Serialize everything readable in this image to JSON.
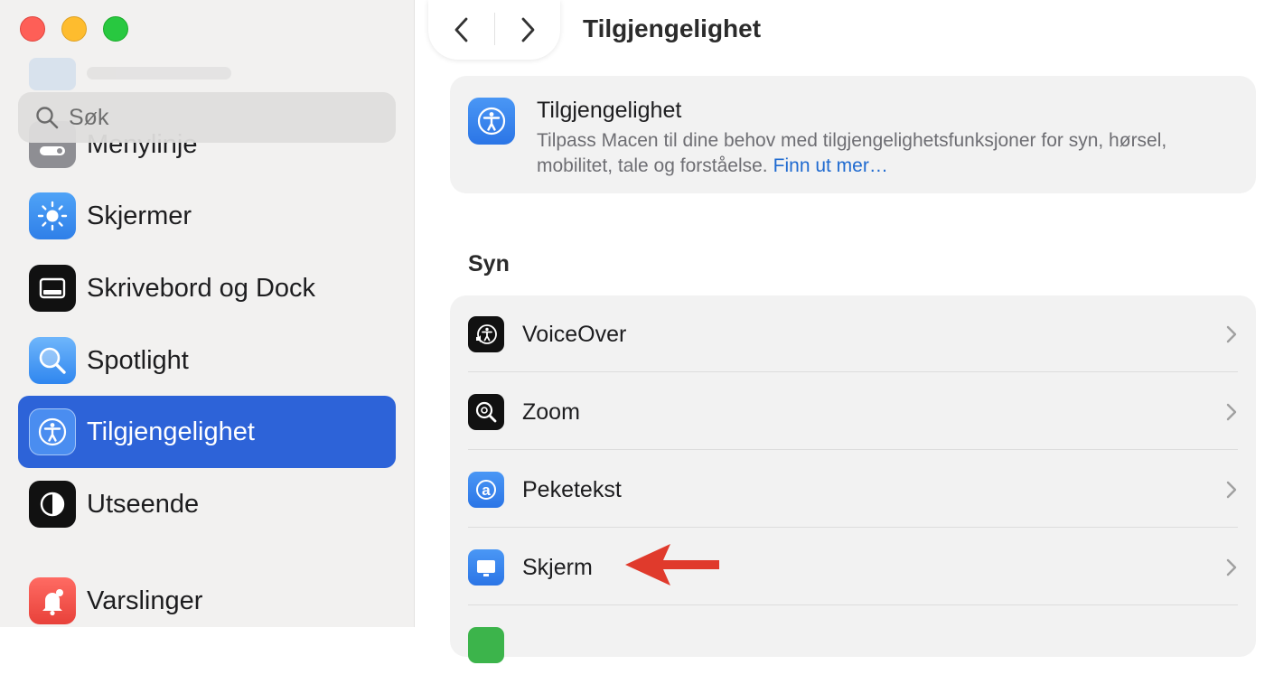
{
  "sidebar": {
    "search": {
      "placeholder": "Søk"
    },
    "items": [
      {
        "label": "Menylinje",
        "icon": "menubar-icon"
      },
      {
        "label": "Skjermer",
        "icon": "brightness-icon"
      },
      {
        "label": "Skrivebord og Dock",
        "icon": "dock-icon"
      },
      {
        "label": "Spotlight",
        "icon": "magnifier-icon"
      },
      {
        "label": "Tilgjengelighet",
        "icon": "accessibility-icon",
        "selected": true
      },
      {
        "label": "Utseende",
        "icon": "appearance-icon"
      },
      {
        "label": "Varslinger",
        "icon": "bell-icon"
      }
    ]
  },
  "toolbar": {
    "title": "Tilgjengelighet"
  },
  "intro": {
    "title": "Tilgjengelighet",
    "description": "Tilpass Macen til dine behov med tilgjengelighetsfunksjoner for syn, hørsel, mobilitet, tale og forståelse.",
    "link": "Finn ut mer…"
  },
  "section": {
    "title": "Syn",
    "rows": [
      {
        "label": "VoiceOver",
        "icon": "voiceover-icon"
      },
      {
        "label": "Zoom",
        "icon": "zoom-icon"
      },
      {
        "label": "Peketekst",
        "icon": "hover-text-icon"
      },
      {
        "label": "Skjerm",
        "icon": "display-icon"
      }
    ]
  },
  "colors": {
    "accent": "#2d63d8",
    "link": "#1f6ad0",
    "annotation_arrow": "#e03a2c"
  }
}
